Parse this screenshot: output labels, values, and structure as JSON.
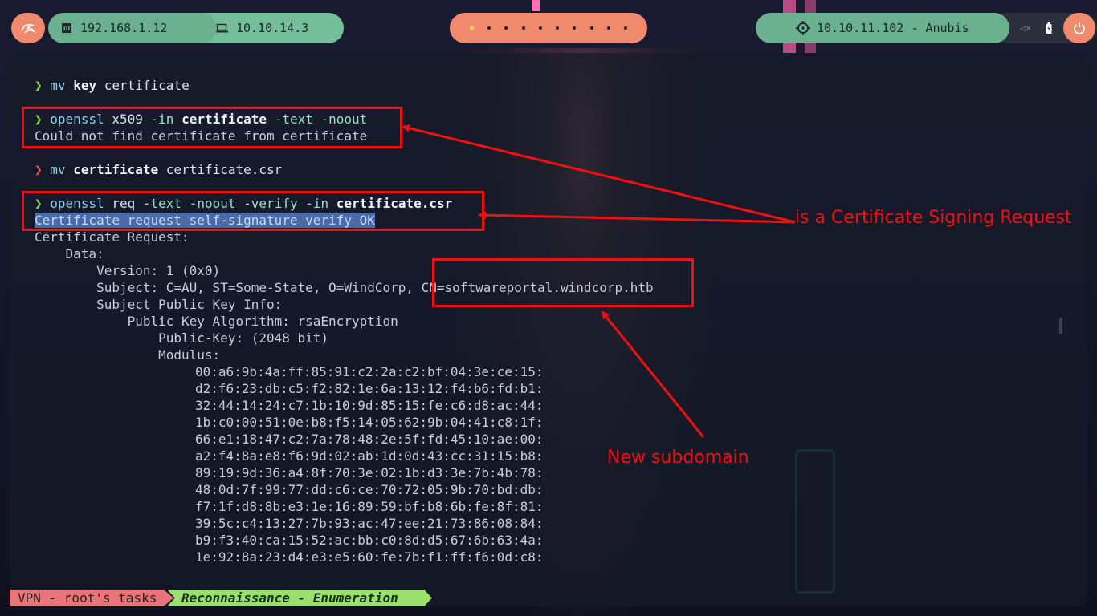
{
  "topbar": {
    "menu_icon": "kali-dragon-icon",
    "lan_icon": "ethernet-icon",
    "lan_ip": "192.168.1.12",
    "vpn_icon": "laptop-icon",
    "vpn_ip": "10.10.14.3",
    "workspaces": [
      "",
      "",
      "",
      "",
      "",
      "",
      "",
      "",
      "",
      ""
    ],
    "target_icon": "crosshair-icon",
    "target": "10.10.11.102 - Anubis",
    "volume_icon": "speaker-muted-icon",
    "battery_icon": "battery-icon",
    "power_icon": "power-icon"
  },
  "terminal": {
    "l1": {
      "prompt": "❯",
      "cmd": "mv",
      "a1": "key",
      "a2": "certificate"
    },
    "l2": {
      "prompt": "❯",
      "cmd": "openssl",
      "a1": "x509",
      "o1": "-in",
      "a2": "certificate",
      "o2": "-text",
      "o3": "-noout"
    },
    "l3": "Could not find certificate from certificate",
    "l4": {
      "prompt": "❯",
      "cmd": "mv",
      "a1": "certificate",
      "a2": "certificate.csr"
    },
    "l5": {
      "prompt": "❯",
      "cmd": "openssl",
      "a1": "req",
      "o1": "-text",
      "o2": "-noout",
      "o3": "-verify",
      "o4": "-in",
      "a2": "certificate.csr"
    },
    "l6": "Certificate request self-signature verify OK",
    "l7": "Certificate Request:",
    "l8": "    Data:",
    "l9": "        Version: 1 (0x0)",
    "l10": "        Subject: C=AU, ST=Some-State, O=WindCorp, CN=softwareportal.windcorp.htb",
    "l11": "        Subject Public Key Info:",
    "l12": "            Public Key Algorithm: rsaEncryption",
    "l13": "                Public-Key: (2048 bit)",
    "l14": "                Modulus:",
    "modulus": [
      "00:a6:9b:4a:ff:85:91:c2:2a:c2:bf:04:3e:ce:15:",
      "d2:f6:23:db:c5:f2:82:1e:6a:13:12:f4:b6:fd:b1:",
      "32:44:14:24:c7:1b:10:9d:85:15:fe:c6:d8:ac:44:",
      "1b:c0:00:51:0e:b8:f5:14:05:62:9b:04:41:c8:1f:",
      "66:e1:18:47:c2:7a:78:48:2e:5f:fd:45:10:ae:00:",
      "a2:f4:8a:e8:f6:9d:02:ab:1d:0d:43:cc:31:15:b8:",
      "89:19:9d:36:a4:8f:70:3e:02:1b:d3:3e:7b:4b:78:",
      "48:0d:7f:99:77:dd:c6:ce:70:72:05:9b:70:bd:db:",
      "f7:1f:d8:8b:e3:1e:16:89:59:bf:b8:6b:fe:8f:81:",
      "39:5c:c4:13:27:7b:93:ac:47:ee:21:73:86:08:84:",
      "b9:f3:40:ca:15:52:ac:bb:c0:8d:d5:67:6b:63:4a:",
      "1e:92:8a:23:d4:e3:e5:60:fe:7b:f1:ff:f6:0d:c8:"
    ]
  },
  "annotations": {
    "csr_note": "is a Certificate Signing Request",
    "subdomain_note": "New subdomain",
    "color": "#f01010"
  },
  "statusbar": {
    "session": "VPN - root's tasks",
    "window": "Reconnaissance - Enumeration"
  }
}
